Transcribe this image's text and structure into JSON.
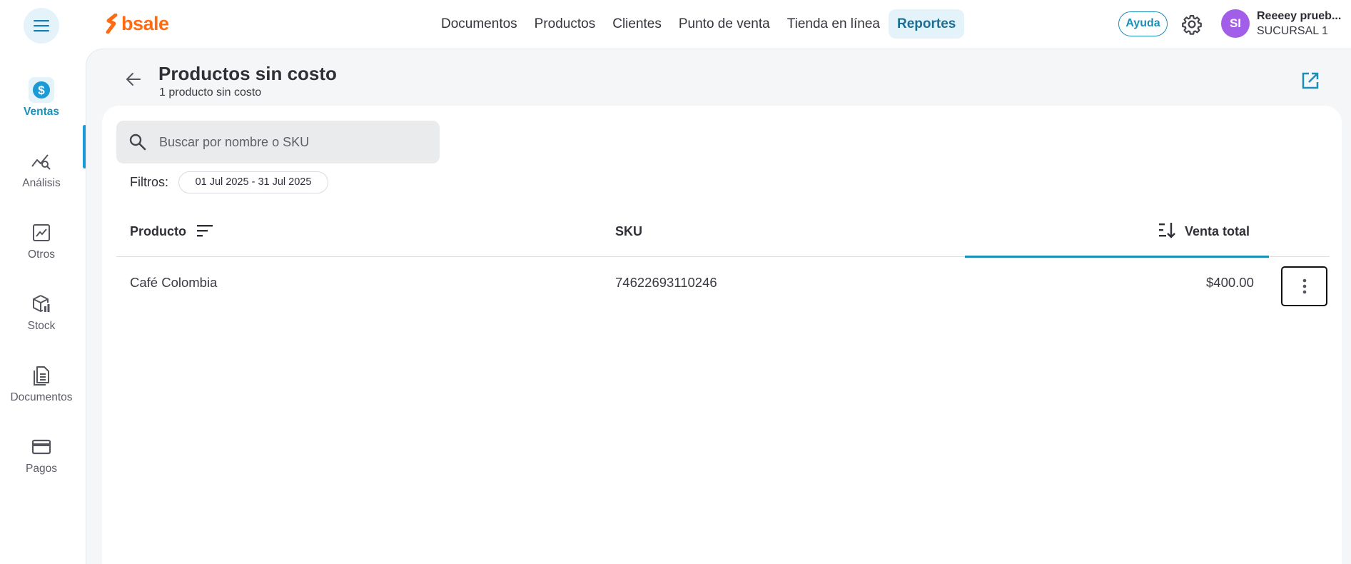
{
  "header": {
    "logo_text": "bsale",
    "nav": [
      "Documentos",
      "Productos",
      "Clientes",
      "Punto de venta",
      "Tienda en línea",
      "Reportes"
    ],
    "active_nav": "Reportes",
    "help_label": "Ayuda",
    "user": {
      "initials": "SI",
      "name": "Reeeey prueb...",
      "branch": "SUCURSAL 1"
    }
  },
  "sidebar": {
    "items": [
      {
        "label": "Ventas",
        "icon": "dollar-icon",
        "active": true
      },
      {
        "label": "Análisis",
        "icon": "analytics-icon",
        "active": false
      },
      {
        "label": "Otros",
        "icon": "chart-icon",
        "active": false
      },
      {
        "label": "Stock",
        "icon": "box-icon",
        "active": false
      },
      {
        "label": "Documentos",
        "icon": "document-icon",
        "active": false
      },
      {
        "label": "Pagos",
        "icon": "card-icon",
        "active": false
      }
    ]
  },
  "page": {
    "title": "Productos sin costo",
    "subtitle": "1 producto sin costo"
  },
  "search": {
    "placeholder": "Buscar por nombre o SKU",
    "value": ""
  },
  "filters": {
    "label": "Filtros:",
    "date_range": "01 Jul 2025 - 31 Jul 2025"
  },
  "table": {
    "columns": [
      "Producto",
      "SKU",
      "Venta total"
    ],
    "rows": [
      {
        "product": "Café Colombia",
        "sku": "74622693110246",
        "total": "$400.00"
      }
    ]
  },
  "colors": {
    "brand": "#ff6a13",
    "accent": "#1a8fb8",
    "avatar": "#a25ee8"
  }
}
